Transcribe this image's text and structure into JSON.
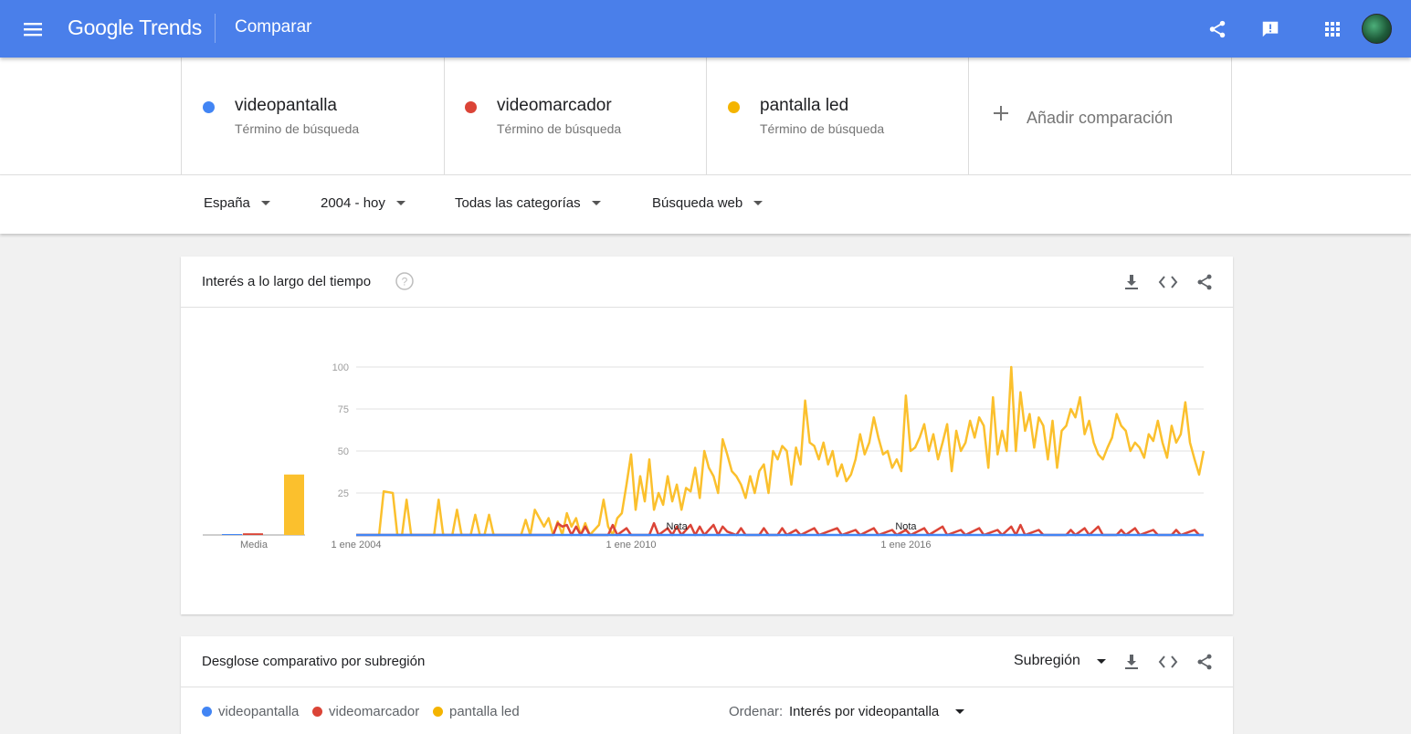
{
  "header": {
    "logo_google": "Google",
    "logo_trends": "Trends",
    "page_title": "Comparar",
    "icons": [
      "menu-icon",
      "share-icon",
      "feedback-icon",
      "apps-icon",
      "avatar"
    ]
  },
  "terms": [
    {
      "name": "videopantalla",
      "sub": "Término de búsqueda",
      "color": "#4285f4"
    },
    {
      "name": "videomarcador",
      "sub": "Término de búsqueda",
      "color": "#db4437"
    },
    {
      "name": "pantalla led",
      "sub": "Término de búsqueda",
      "color": "#f4b400"
    }
  ],
  "add_comparison": "Añadir comparación",
  "filters": {
    "region": "España",
    "period": "2004 - hoy",
    "category": "Todas las categorías",
    "search_type": "Búsqueda web"
  },
  "interest_card": {
    "title": "Interés a lo largo del tiempo",
    "average_label": "Media",
    "note_label": "Nota"
  },
  "subregion_card": {
    "title": "Desglose comparativo por subregión",
    "resolution": "Subregión",
    "sort_label": "Ordenar:",
    "sort_value": "Interés por videopantalla",
    "legend": [
      "videopantalla",
      "videomarcador",
      "pantalla led"
    ]
  },
  "chart_data": {
    "type": "line",
    "ylim": [
      0,
      100
    ],
    "yticks": [
      25,
      50,
      75,
      100
    ],
    "x_tick_labels": [
      "1 ene 2004",
      "1 ene 2010",
      "1 ene 2016"
    ],
    "x_ticks_years": [
      2004,
      2010,
      2016
    ],
    "xlim_years": [
      2004,
      2022.5
    ],
    "notes_years": [
      2011,
      2016
    ],
    "averages": [
      {
        "name": "videopantalla",
        "value": 0
      },
      {
        "name": "videomarcador",
        "value": 1
      },
      {
        "name": "pantalla led",
        "value": 36
      }
    ],
    "series": [
      {
        "name": "pantalla led",
        "color": "#fbc02d",
        "points": [
          [
            2004.0,
            0
          ],
          [
            2004.5,
            0
          ],
          [
            2004.6,
            26
          ],
          [
            2004.8,
            25
          ],
          [
            2004.9,
            0
          ],
          [
            2005.0,
            0
          ],
          [
            2005.1,
            21
          ],
          [
            2005.2,
            0
          ],
          [
            2005.7,
            0
          ],
          [
            2005.8,
            21
          ],
          [
            2005.9,
            0
          ],
          [
            2006.1,
            0
          ],
          [
            2006.2,
            15
          ],
          [
            2006.3,
            0
          ],
          [
            2006.5,
            0
          ],
          [
            2006.6,
            12
          ],
          [
            2006.7,
            0
          ],
          [
            2006.8,
            0
          ],
          [
            2006.9,
            12
          ],
          [
            2007.0,
            0
          ],
          [
            2007.6,
            0
          ],
          [
            2007.7,
            9
          ],
          [
            2007.8,
            0
          ],
          [
            2007.9,
            15
          ],
          [
            2008.0,
            10
          ],
          [
            2008.1,
            5
          ],
          [
            2008.2,
            10
          ],
          [
            2008.3,
            0
          ],
          [
            2008.4,
            8
          ],
          [
            2008.5,
            0
          ],
          [
            2008.6,
            13
          ],
          [
            2008.7,
            5
          ],
          [
            2008.8,
            10
          ],
          [
            2008.9,
            0
          ],
          [
            2009.0,
            7
          ],
          [
            2009.1,
            0
          ],
          [
            2009.3,
            6
          ],
          [
            2009.4,
            21
          ],
          [
            2009.5,
            5
          ],
          [
            2009.6,
            0
          ],
          [
            2009.7,
            10
          ],
          [
            2009.8,
            13
          ],
          [
            2009.9,
            30
          ],
          [
            2010.0,
            48
          ],
          [
            2010.1,
            15
          ],
          [
            2010.2,
            35
          ],
          [
            2010.3,
            20
          ],
          [
            2010.4,
            45
          ],
          [
            2010.5,
            15
          ],
          [
            2010.6,
            25
          ],
          [
            2010.7,
            18
          ],
          [
            2010.8,
            35
          ],
          [
            2010.9,
            20
          ],
          [
            2011.0,
            30
          ],
          [
            2011.1,
            15
          ],
          [
            2011.2,
            28
          ],
          [
            2011.3,
            26
          ],
          [
            2011.4,
            40
          ],
          [
            2011.5,
            22
          ],
          [
            2011.6,
            50
          ],
          [
            2011.7,
            40
          ],
          [
            2011.8,
            35
          ],
          [
            2011.9,
            25
          ],
          [
            2012.0,
            57
          ],
          [
            2012.1,
            48
          ],
          [
            2012.2,
            38
          ],
          [
            2012.3,
            35
          ],
          [
            2012.4,
            30
          ],
          [
            2012.5,
            22
          ],
          [
            2012.6,
            35
          ],
          [
            2012.7,
            25
          ],
          [
            2012.8,
            38
          ],
          [
            2012.9,
            42
          ],
          [
            2013.0,
            25
          ],
          [
            2013.1,
            50
          ],
          [
            2013.2,
            45
          ],
          [
            2013.3,
            53
          ],
          [
            2013.4,
            50
          ],
          [
            2013.5,
            30
          ],
          [
            2013.6,
            52
          ],
          [
            2013.7,
            42
          ],
          [
            2013.8,
            80
          ],
          [
            2013.9,
            55
          ],
          [
            2014.0,
            53
          ],
          [
            2014.1,
            45
          ],
          [
            2014.2,
            55
          ],
          [
            2014.3,
            42
          ],
          [
            2014.4,
            50
          ],
          [
            2014.5,
            35
          ],
          [
            2014.6,
            42
          ],
          [
            2014.7,
            32
          ],
          [
            2014.8,
            36
          ],
          [
            2014.9,
            45
          ],
          [
            2015.0,
            60
          ],
          [
            2015.1,
            48
          ],
          [
            2015.2,
            55
          ],
          [
            2015.3,
            70
          ],
          [
            2015.4,
            58
          ],
          [
            2015.5,
            48
          ],
          [
            2015.6,
            50
          ],
          [
            2015.7,
            40
          ],
          [
            2015.8,
            45
          ],
          [
            2015.9,
            38
          ],
          [
            2016.0,
            83
          ],
          [
            2016.1,
            50
          ],
          [
            2016.2,
            52
          ],
          [
            2016.3,
            58
          ],
          [
            2016.4,
            66
          ],
          [
            2016.5,
            50
          ],
          [
            2016.6,
            60
          ],
          [
            2016.7,
            45
          ],
          [
            2016.8,
            55
          ],
          [
            2016.9,
            66
          ],
          [
            2017.0,
            38
          ],
          [
            2017.1,
            62
          ],
          [
            2017.2,
            50
          ],
          [
            2017.3,
            55
          ],
          [
            2017.4,
            68
          ],
          [
            2017.5,
            58
          ],
          [
            2017.6,
            70
          ],
          [
            2017.7,
            65
          ],
          [
            2017.8,
            40
          ],
          [
            2017.9,
            82
          ],
          [
            2018.0,
            48
          ],
          [
            2018.1,
            62
          ],
          [
            2018.2,
            50
          ],
          [
            2018.3,
            100
          ],
          [
            2018.4,
            50
          ],
          [
            2018.5,
            85
          ],
          [
            2018.6,
            62
          ],
          [
            2018.7,
            72
          ],
          [
            2018.8,
            52
          ],
          [
            2018.9,
            70
          ],
          [
            2019.0,
            65
          ],
          [
            2019.1,
            45
          ],
          [
            2019.2,
            68
          ],
          [
            2019.3,
            40
          ],
          [
            2019.4,
            62
          ],
          [
            2019.5,
            65
          ],
          [
            2019.6,
            75
          ],
          [
            2019.7,
            70
          ],
          [
            2019.8,
            82
          ],
          [
            2019.9,
            60
          ],
          [
            2020.0,
            68
          ],
          [
            2020.1,
            55
          ],
          [
            2020.2,
            48
          ],
          [
            2020.3,
            45
          ],
          [
            2020.4,
            52
          ],
          [
            2020.5,
            58
          ],
          [
            2020.6,
            72
          ],
          [
            2020.7,
            65
          ],
          [
            2020.8,
            62
          ],
          [
            2020.9,
            50
          ],
          [
            2021.0,
            55
          ],
          [
            2021.1,
            52
          ],
          [
            2021.2,
            46
          ],
          [
            2021.3,
            60
          ],
          [
            2021.4,
            56
          ],
          [
            2021.5,
            68
          ],
          [
            2021.6,
            55
          ],
          [
            2021.7,
            46
          ],
          [
            2021.8,
            65
          ],
          [
            2021.9,
            55
          ],
          [
            2022.0,
            60
          ],
          [
            2022.1,
            79
          ],
          [
            2022.2,
            55
          ],
          [
            2022.3,
            45
          ],
          [
            2022.4,
            36
          ],
          [
            2022.5,
            50
          ]
        ]
      },
      {
        "name": "videomarcador",
        "color": "#db4437",
        "points": [
          [
            2004.0,
            0
          ],
          [
            2008.3,
            0
          ],
          [
            2008.4,
            7
          ],
          [
            2008.5,
            5
          ],
          [
            2008.6,
            6
          ],
          [
            2008.7,
            0
          ],
          [
            2008.8,
            5
          ],
          [
            2008.9,
            0
          ],
          [
            2009.0,
            5
          ],
          [
            2009.1,
            0
          ],
          [
            2009.5,
            0
          ],
          [
            2009.6,
            6
          ],
          [
            2009.7,
            0
          ],
          [
            2009.9,
            4
          ],
          [
            2010.0,
            0
          ],
          [
            2010.4,
            0
          ],
          [
            2010.5,
            7
          ],
          [
            2010.6,
            0
          ],
          [
            2010.8,
            4
          ],
          [
            2010.9,
            0
          ],
          [
            2011.0,
            5
          ],
          [
            2011.1,
            0
          ],
          [
            2011.3,
            6
          ],
          [
            2011.4,
            0
          ],
          [
            2011.5,
            5
          ],
          [
            2011.6,
            0
          ],
          [
            2011.8,
            6
          ],
          [
            2011.9,
            0
          ],
          [
            2012.0,
            5
          ],
          [
            2012.1,
            2
          ],
          [
            2012.3,
            0
          ],
          [
            2012.4,
            4
          ],
          [
            2012.5,
            0
          ],
          [
            2012.8,
            0
          ],
          [
            2012.9,
            4
          ],
          [
            2013.0,
            0
          ],
          [
            2013.2,
            0
          ],
          [
            2013.3,
            4
          ],
          [
            2013.4,
            0
          ],
          [
            2013.6,
            3
          ],
          [
            2013.7,
            0
          ],
          [
            2014.0,
            4
          ],
          [
            2014.1,
            0
          ],
          [
            2014.5,
            4
          ],
          [
            2014.6,
            0
          ],
          [
            2014.9,
            3
          ],
          [
            2015.0,
            0
          ],
          [
            2015.3,
            4
          ],
          [
            2015.4,
            0
          ],
          [
            2015.7,
            3
          ],
          [
            2015.8,
            0
          ],
          [
            2016.0,
            3
          ],
          [
            2016.1,
            0
          ],
          [
            2016.4,
            4
          ],
          [
            2016.5,
            0
          ],
          [
            2016.8,
            5
          ],
          [
            2016.9,
            0
          ],
          [
            2017.2,
            3
          ],
          [
            2017.3,
            0
          ],
          [
            2017.6,
            4
          ],
          [
            2017.7,
            0
          ],
          [
            2018.0,
            3
          ],
          [
            2018.1,
            0
          ],
          [
            2018.3,
            5
          ],
          [
            2018.4,
            0
          ],
          [
            2018.5,
            6
          ],
          [
            2018.6,
            0
          ],
          [
            2018.9,
            3
          ],
          [
            2019.0,
            0
          ],
          [
            2019.5,
            0
          ],
          [
            2019.6,
            3
          ],
          [
            2019.7,
            0
          ],
          [
            2019.9,
            4
          ],
          [
            2020.0,
            0
          ],
          [
            2020.2,
            5
          ],
          [
            2020.3,
            0
          ],
          [
            2020.6,
            0
          ],
          [
            2020.7,
            3
          ],
          [
            2020.8,
            0
          ],
          [
            2021.0,
            4
          ],
          [
            2021.1,
            0
          ],
          [
            2021.4,
            3
          ],
          [
            2021.5,
            0
          ],
          [
            2021.8,
            0
          ],
          [
            2021.9,
            3
          ],
          [
            2022.0,
            0
          ],
          [
            2022.2,
            2
          ],
          [
            2022.3,
            3
          ],
          [
            2022.4,
            0
          ],
          [
            2022.5,
            0
          ]
        ]
      },
      {
        "name": "videopantalla",
        "color": "#4285f4",
        "points": [
          [
            2004.0,
            0
          ],
          [
            2022.5,
            0
          ]
        ]
      }
    ]
  }
}
